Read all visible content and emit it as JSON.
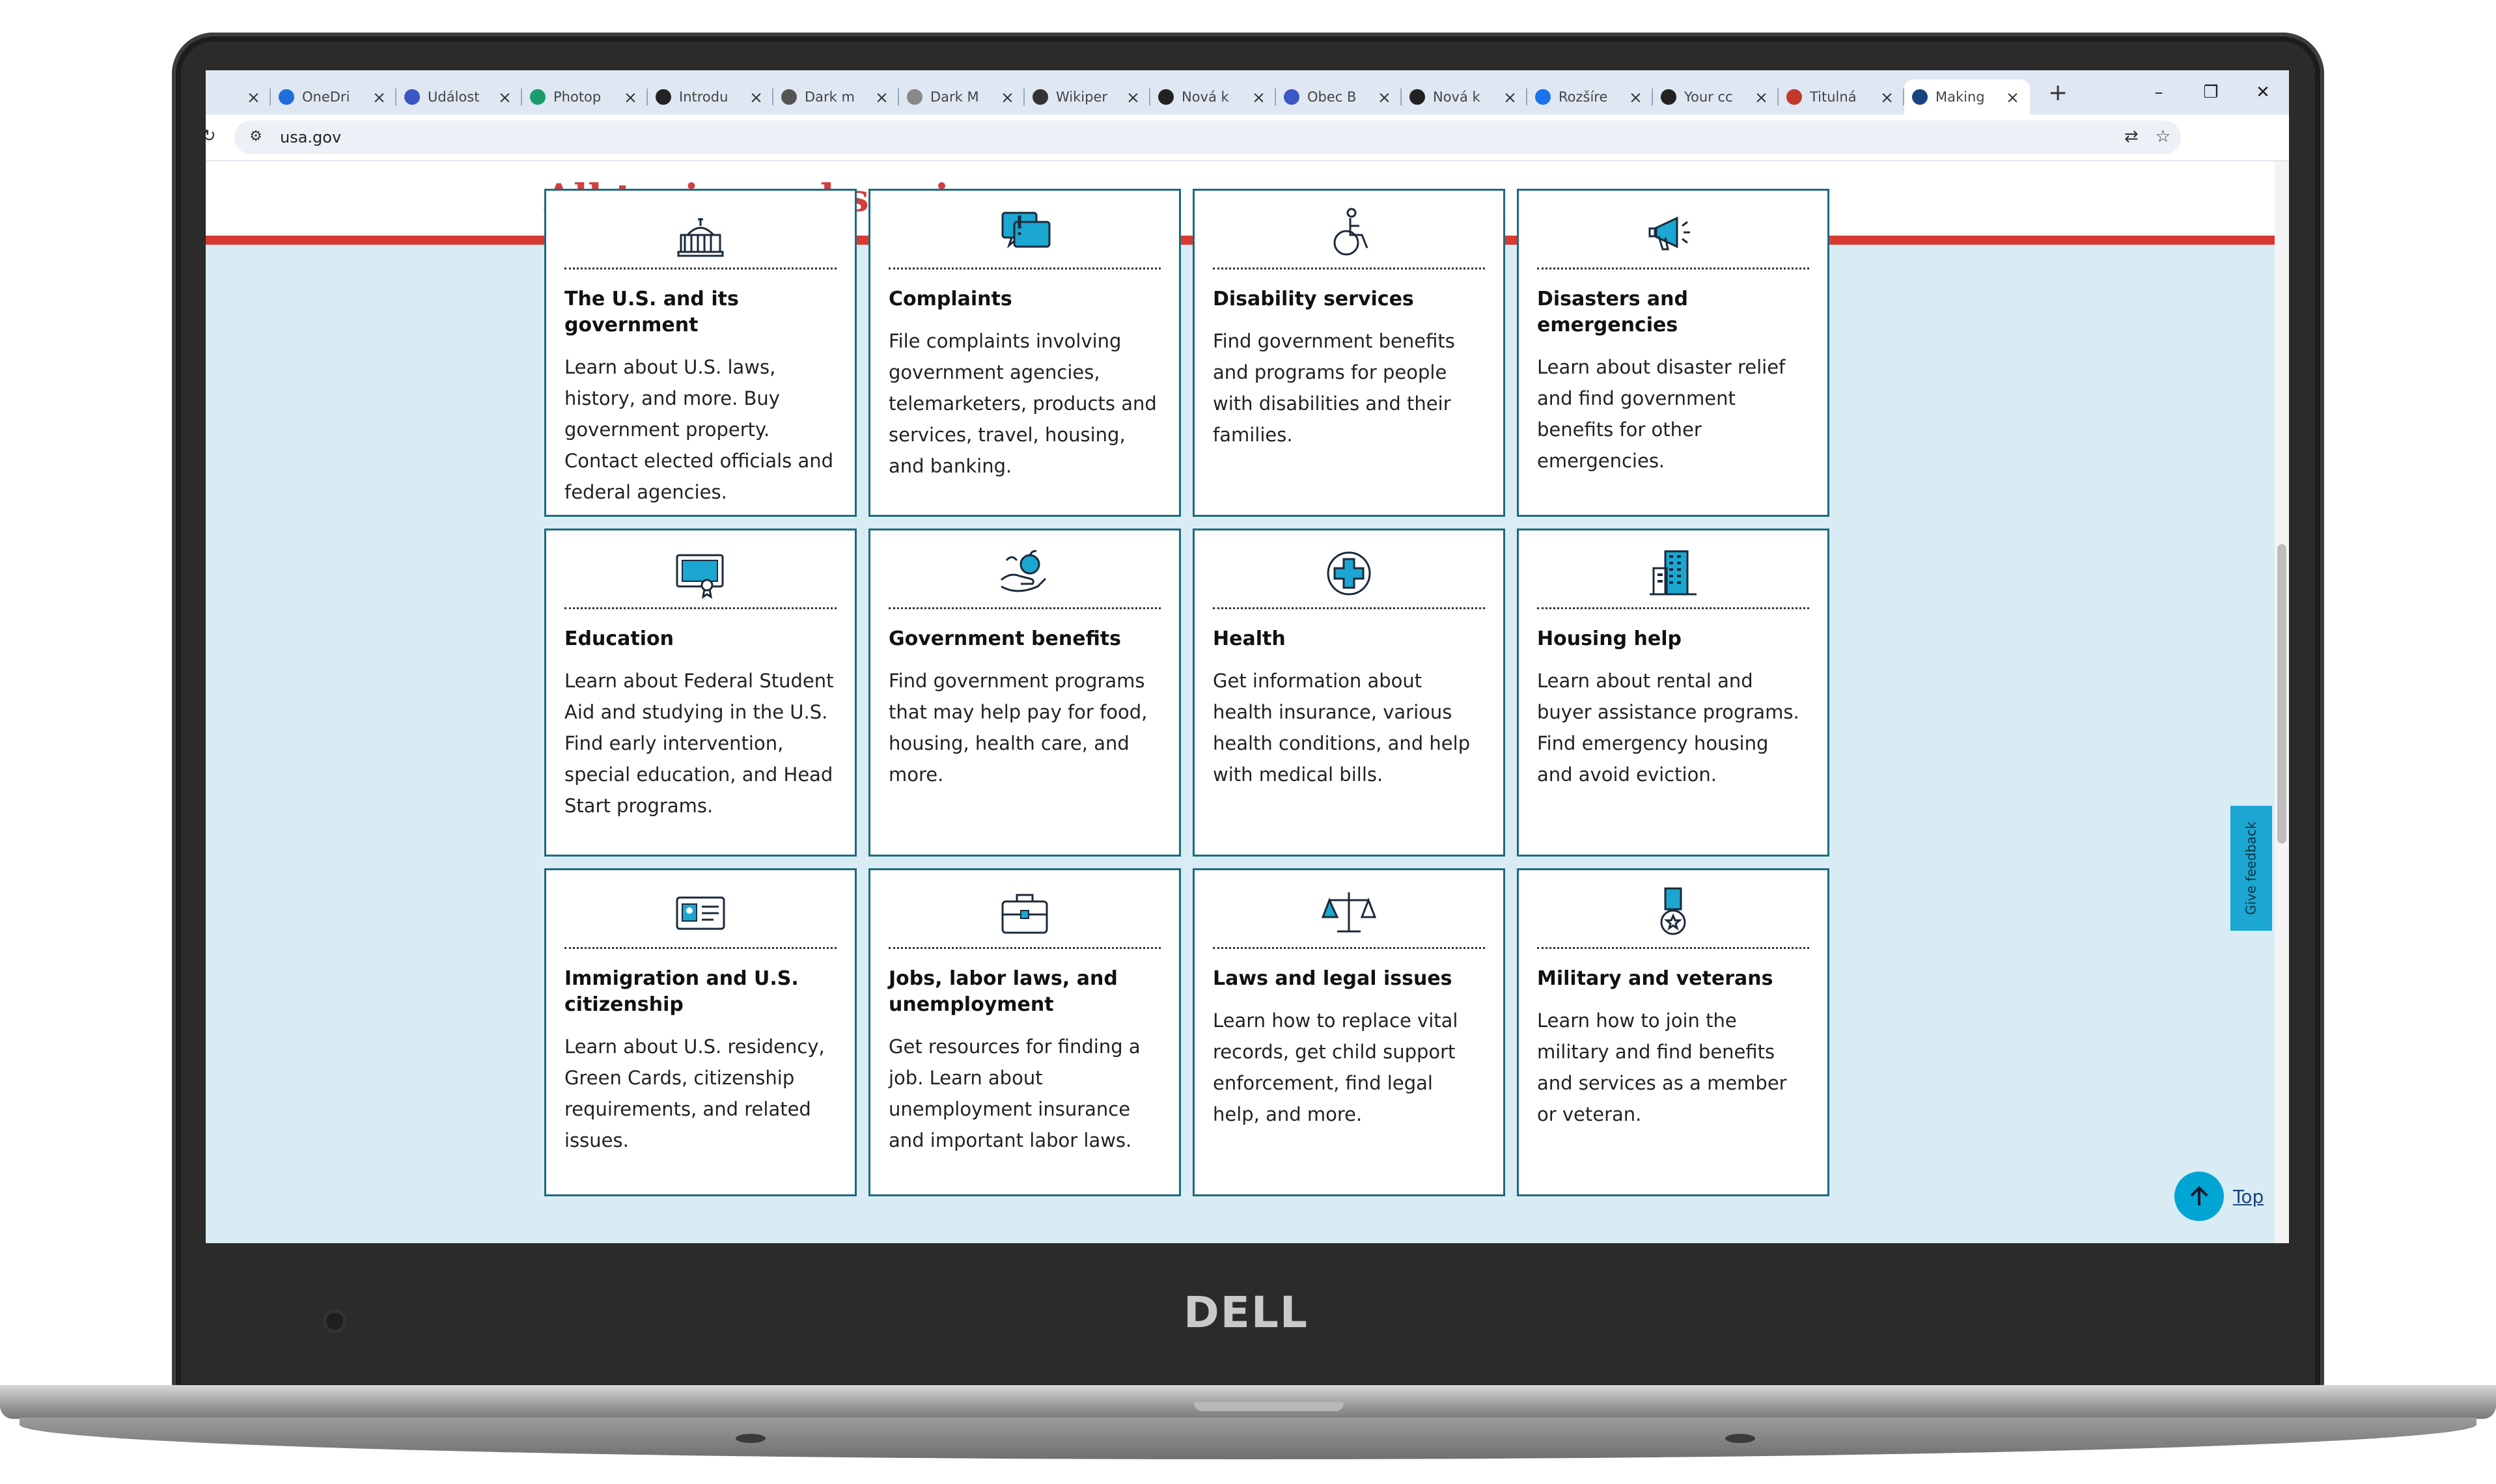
{
  "browser": {
    "tabs": [
      {
        "title": "",
        "icon": "generic-icon",
        "color": "#777777"
      },
      {
        "title": "OneDri",
        "icon": "onedrive-icon",
        "color": "#1e6fd9"
      },
      {
        "title": "Událost",
        "icon": "shield-icon",
        "color": "#3b57c4"
      },
      {
        "title": "Photop",
        "icon": "photopea-icon",
        "color": "#1a9c6b"
      },
      {
        "title": "Introdu",
        "icon": "github-icon",
        "color": "#222222"
      },
      {
        "title": "Dark m",
        "icon": "generic-icon",
        "color": "#555555"
      },
      {
        "title": "Dark M",
        "icon": "generic-icon",
        "color": "#888888"
      },
      {
        "title": "Wikiper",
        "icon": "wikipedia-icon",
        "color": "#333333"
      },
      {
        "title": "Nová k",
        "icon": "chatgpt-icon",
        "color": "#222222"
      },
      {
        "title": "Obec B",
        "icon": "shield-icon",
        "color": "#3b57c4"
      },
      {
        "title": "Nová k",
        "icon": "chatgpt-icon",
        "color": "#222222"
      },
      {
        "title": "Rozšíre",
        "icon": "puzzle-icon",
        "color": "#1a73e8"
      },
      {
        "title": "Your cc",
        "icon": "notion-icon",
        "color": "#222222"
      },
      {
        "title": "Titulná",
        "icon": "sk-icon",
        "color": "#c0392b"
      },
      {
        "title": "Making",
        "icon": "usagov-icon",
        "color": "#1a4480",
        "active": true
      }
    ],
    "new_tab": "+",
    "window_controls": {
      "minimize": "–",
      "restore": "❐",
      "close": "✕"
    },
    "url": "usa.gov"
  },
  "page": {
    "title": "All topics and services",
    "feedback_label": "Give feedback",
    "top_label": "Top",
    "cards": [
      {
        "icon": "capitol-building-icon",
        "title": "The U.S. and its government",
        "desc": "Learn about U.S. laws, history, and more. Buy government property. Contact elected officials and federal agencies."
      },
      {
        "icon": "complaint-speech-bubble-icon",
        "title": "Complaints",
        "desc": "File complaints involving government agencies, telemarketers, products and services, travel, housing, and banking."
      },
      {
        "icon": "wheelchair-icon",
        "title": "Disability services",
        "desc": "Find government benefits and programs for people with disabilities and their families."
      },
      {
        "icon": "megaphone-icon",
        "title": "Disasters and emergencies",
        "desc": "Learn about disaster relief and find government benefits for other emergencies."
      },
      {
        "icon": "diploma-icon",
        "title": "Education",
        "desc": "Learn about Federal Student Aid and studying in the U.S. Find early intervention, special education, and Head Start programs."
      },
      {
        "icon": "hand-apple-icon",
        "title": "Government benefits",
        "desc": "Find government programs that may help pay for food, housing, health care, and more."
      },
      {
        "icon": "medical-cross-icon",
        "title": "Health",
        "desc": "Get information about health insurance, various health conditions, and help with medical bills."
      },
      {
        "icon": "apartment-building-icon",
        "title": "Housing help",
        "desc": "Learn about rental and buyer assistance programs. Find emergency housing and avoid eviction."
      },
      {
        "icon": "id-card-icon",
        "title": "Immigration and U.S. citizenship",
        "desc": "Learn about U.S. residency, Green Cards, citizenship requirements, and related issues."
      },
      {
        "icon": "briefcase-icon",
        "title": "Jobs, labor laws, and unemployment",
        "desc": "Get resources for finding a job. Learn about unemployment insurance and important labor laws."
      },
      {
        "icon": "scales-of-justice-icon",
        "title": "Laws and legal issues",
        "desc": "Learn how to replace vital records, get child support enforcement, find legal help, and more."
      },
      {
        "icon": "military-medal-icon",
        "title": "Military and veterans",
        "desc": "Learn how to join the military and find benefits and services as a member or veteran."
      }
    ]
  },
  "device": {
    "brand": "DELL"
  },
  "colors": {
    "accent_red": "#d83933",
    "card_border": "#1a6b82",
    "panel_bg": "#d9ecf3",
    "feedback_tab": "#1ba7d1"
  }
}
